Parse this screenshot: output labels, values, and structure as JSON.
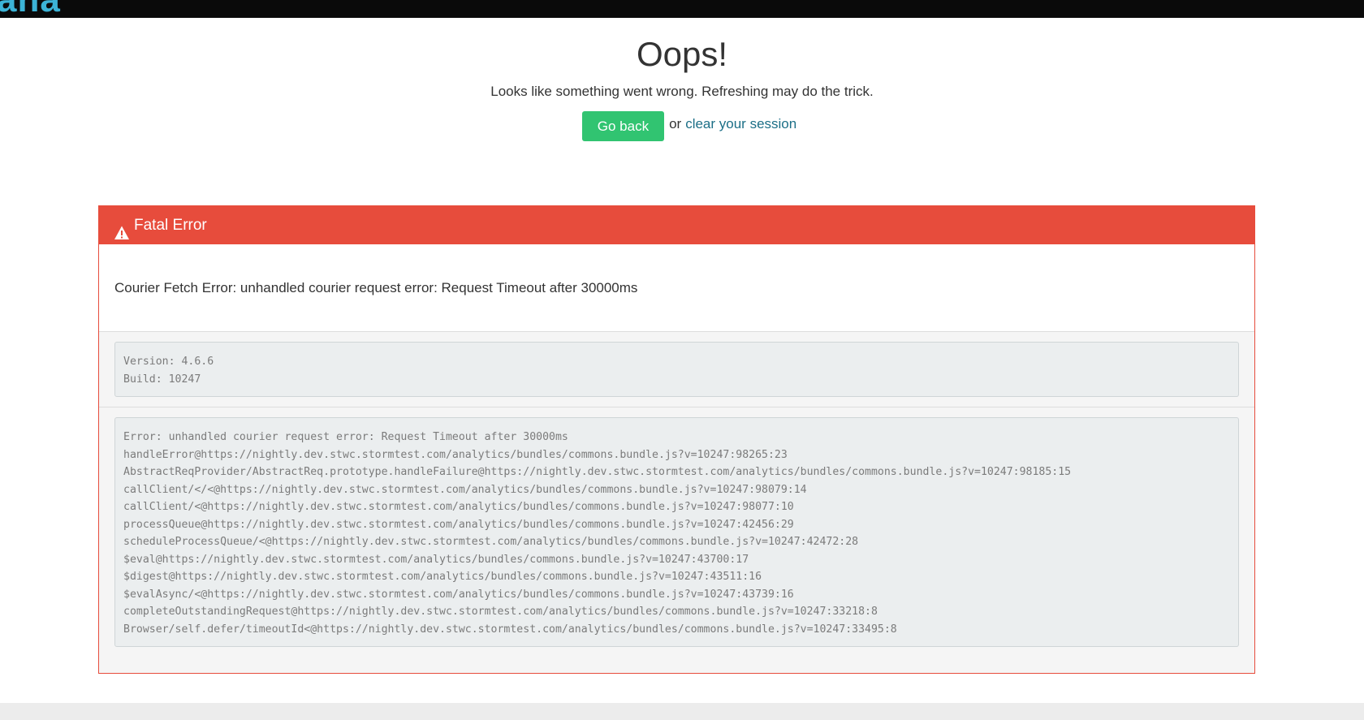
{
  "header": {
    "logo_fragment": "ana"
  },
  "error_page": {
    "title": "Oops!",
    "subtitle": "Looks like something went wrong. Refreshing may do the trick.",
    "go_back_label": "Go back",
    "or_text": "or",
    "clear_session_label": "clear your session"
  },
  "panel": {
    "heading": "Fatal Error",
    "heading_icon": "warning-triangle-icon",
    "message": "Courier Fetch Error: unhandled courier request error: Request Timeout after 30000ms",
    "version_info": "Version: 4.6.6\nBuild: 10247",
    "stack_trace": "Error: unhandled courier request error: Request Timeout after 30000ms\nhandleError@https://nightly.dev.stwc.stormtest.com/analytics/bundles/commons.bundle.js?v=10247:98265:23\nAbstractReqProvider/AbstractReq.prototype.handleFailure@https://nightly.dev.stwc.stormtest.com/analytics/bundles/commons.bundle.js?v=10247:98185:15\ncallClient/</<@https://nightly.dev.stwc.stormtest.com/analytics/bundles/commons.bundle.js?v=10247:98079:14\ncallClient/<@https://nightly.dev.stwc.stormtest.com/analytics/bundles/commons.bundle.js?v=10247:98077:10\nprocessQueue@https://nightly.dev.stwc.stormtest.com/analytics/bundles/commons.bundle.js?v=10247:42456:29\nscheduleProcessQueue/<@https://nightly.dev.stwc.stormtest.com/analytics/bundles/commons.bundle.js?v=10247:42472:28\n$eval@https://nightly.dev.stwc.stormtest.com/analytics/bundles/commons.bundle.js?v=10247:43700:17\n$digest@https://nightly.dev.stwc.stormtest.com/analytics/bundles/commons.bundle.js?v=10247:43511:16\n$evalAsync/<@https://nightly.dev.stwc.stormtest.com/analytics/bundles/commons.bundle.js?v=10247:43739:16\ncompleteOutstandingRequest@https://nightly.dev.stwc.stormtest.com/analytics/bundles/commons.bundle.js?v=10247:33218:8\nBrowser/self.defer/timeoutId<@https://nightly.dev.stwc.stormtest.com/analytics/bundles/commons.bundle.js?v=10247:33495:8"
  },
  "colors": {
    "topbar": "#0a0a0a",
    "logo": "#3cb3d6",
    "go_back_button": "#31c471",
    "link": "#1c6f87",
    "panel_danger": "#e74c3c",
    "code_background": "#ebeeef",
    "footer": "#ececec"
  }
}
